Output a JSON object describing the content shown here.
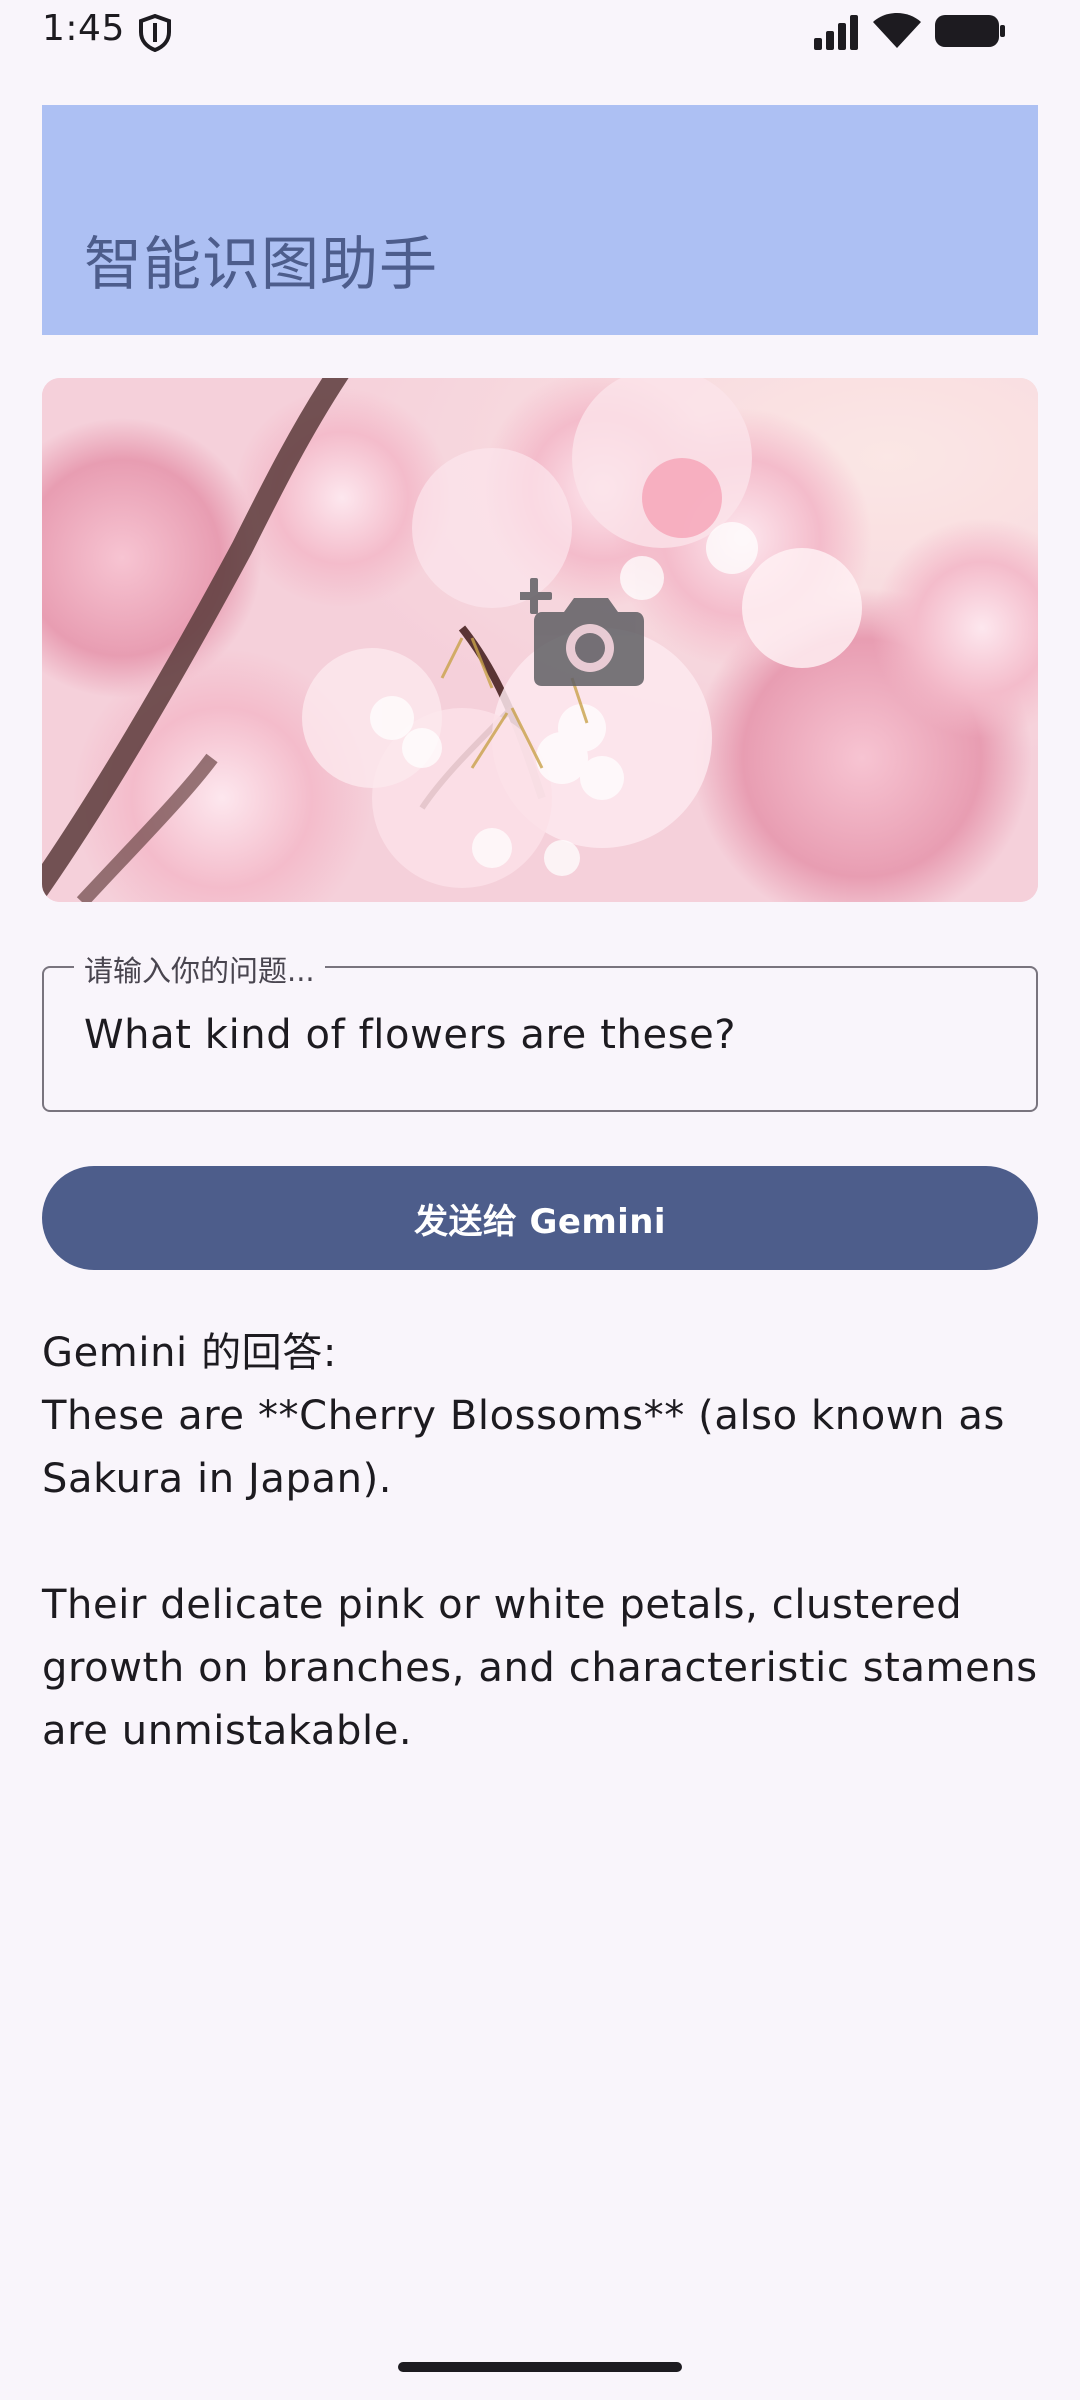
{
  "status_bar": {
    "time": "1:45",
    "icons": [
      "shield-icon",
      "signal-icon",
      "wifi-icon",
      "battery-icon"
    ]
  },
  "header": {
    "title": "智能识图助手",
    "background_color": "#adc0f3"
  },
  "image_card": {
    "overlay_icon": "add-photo-camera-icon"
  },
  "question_field": {
    "label": "请输入你的问题...",
    "value": "What kind of flowers are these?"
  },
  "send_button": {
    "label": "发送给 Gemini",
    "color": "#4d5d8b"
  },
  "answer": {
    "heading": "Gemini 的回答:",
    "line1": "These are **Cherry Blossoms** (also known as Sakura in Japan).",
    "line2": "Their delicate pink or white petals, clustered growth on branches, and characteristic stamens are unmistakable."
  }
}
